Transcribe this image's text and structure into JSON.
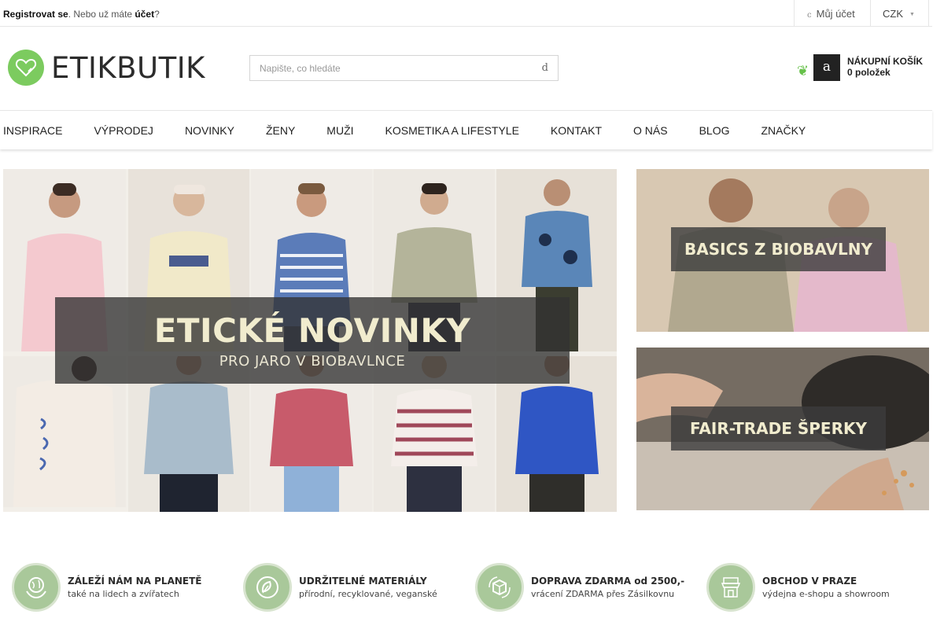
{
  "topbar": {
    "register_link": "Registrovat se",
    "register_middle": ". Nebo už máte ",
    "account_link": "účet",
    "register_end": "?",
    "account_icon": "c",
    "account_label": "Můj účet",
    "currency": "CZK",
    "currency_caret": "▼"
  },
  "header": {
    "logo_text": "ETIKBUTIK",
    "search_placeholder": "Napište, co hledáte",
    "search_button_glyph": "d",
    "cart_leaf": "❦",
    "cart_icon_glyph": "a",
    "cart_title": "NÁKUPNÍ KOŠÍK",
    "cart_count": "0 položek"
  },
  "nav": {
    "items": [
      "INSPIRACE",
      "VÝPRODEJ",
      "NOVINKY",
      "ŽENY",
      "MUŽI",
      "KOSMETIKA A LIFESTYLE",
      "KONTAKT",
      "O NÁS",
      "BLOG",
      "ZNAČKY"
    ]
  },
  "banners": {
    "main_title": "ETICKÉ NOVINKY",
    "main_subtitle": "PRO JARO V BIOBAVLNCE",
    "side1": "BASICS Z BIOBAVLNY",
    "side2": "FAIR-TRADE ŠPERKY"
  },
  "features": [
    {
      "title": "ZÁLEŽÍ NÁM NA PLANETĚ",
      "subtitle": "také na lidech a zvířatech",
      "icon": "globe-hands-icon"
    },
    {
      "title": "UDRŽITELNÉ MATERIÁLY",
      "subtitle": "přírodní, recyklované, veganské",
      "icon": "leaf-icon"
    },
    {
      "title": "DOPRAVA ZDARMA od 2500,-",
      "subtitle": "vrácení ZDARMA přes Zásilkovnu",
      "icon": "package-icon"
    },
    {
      "title": "OBCHOD V PRAZE",
      "subtitle": "výdejna e-shopu a showroom",
      "icon": "shop-icon"
    }
  ],
  "colors": {
    "brand_green": "#7ccb5f",
    "overlay_text": "#f1ecce",
    "feature_icon_bg": "#a9c89a"
  }
}
